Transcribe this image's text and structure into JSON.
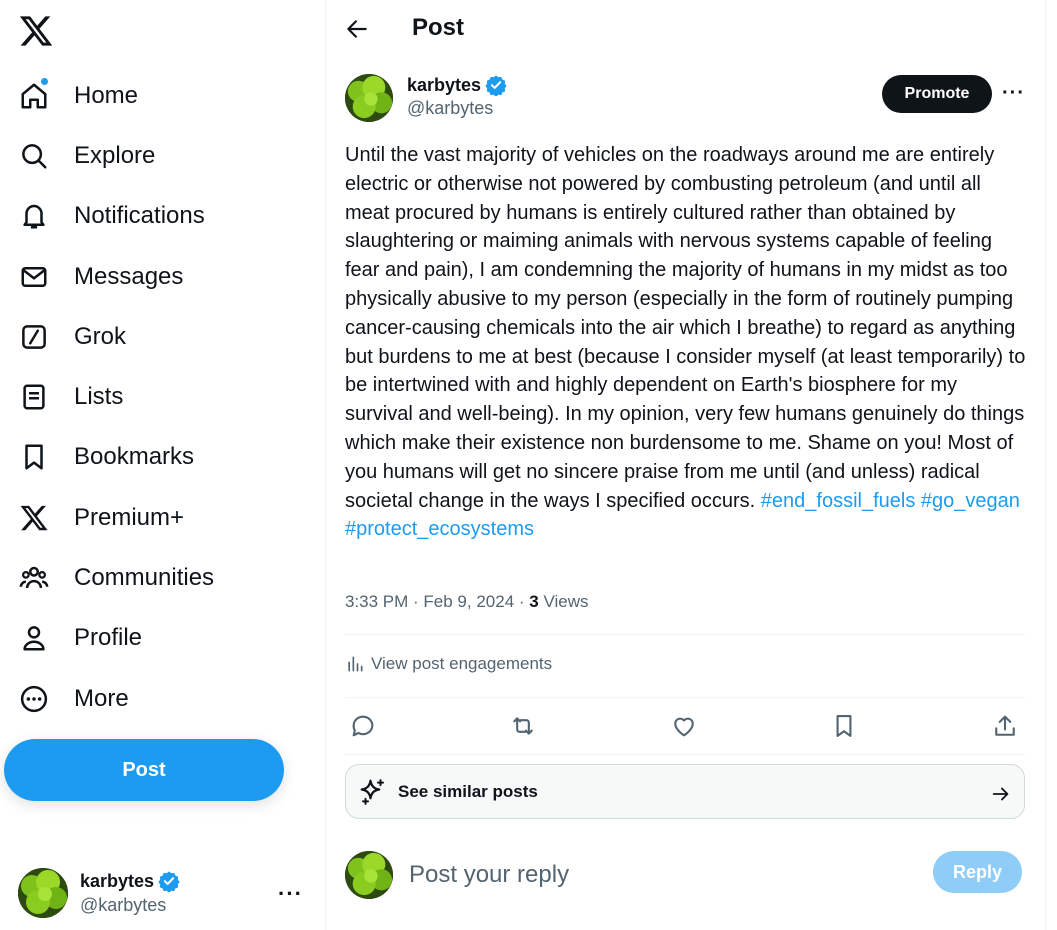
{
  "nav": {
    "items": [
      {
        "label": "Home",
        "icon": "home-icon"
      },
      {
        "label": "Explore",
        "icon": "search-icon"
      },
      {
        "label": "Notifications",
        "icon": "bell-icon"
      },
      {
        "label": "Messages",
        "icon": "envelope-icon"
      },
      {
        "label": "Grok",
        "icon": "grok-icon"
      },
      {
        "label": "Lists",
        "icon": "list-icon"
      },
      {
        "label": "Bookmarks",
        "icon": "bookmark-icon"
      },
      {
        "label": "Premium+",
        "icon": "x-logo-icon"
      },
      {
        "label": "Communities",
        "icon": "people-icon"
      },
      {
        "label": "Profile",
        "icon": "person-icon"
      },
      {
        "label": "More",
        "icon": "more-circle-icon"
      }
    ],
    "post_button": "Post"
  },
  "account": {
    "name": "karbytes",
    "handle": "@karbytes"
  },
  "header": {
    "title": "Post"
  },
  "post": {
    "author_name": "karbytes",
    "author_handle": "@karbytes",
    "promote_label": "Promote",
    "body": "Until the vast majority of vehicles on the roadways around me are entirely electric or otherwise not powered by combusting petroleum (and until all meat procured by humans is entirely cultured rather than obtained by slaughtering or maiming animals with nervous systems capable of feeling fear and pain), I am condemning the majority of humans in my midst as too physically abusive to my person (especially in the form of routinely pumping cancer-causing chemicals into the air which I breathe) to regard as anything but burdens to me at best (because I consider myself (at least temporarily) to be intertwined with and highly dependent on Earth's biosphere for my survival and well-being). In my opinion, very few humans genuinely do things which make their existence non burdensome to me. Shame on you! Most of you humans will get no sincere praise from me until (and unless) radical societal change in the ways I specified occurs.",
    "hashtags": [
      "#end_fossil_fuels",
      "#go_vegan",
      "#protect_ecosystems"
    ],
    "timestamp": "3:33 PM · Feb 9, 2024 · ",
    "views_count": "3",
    "views_label": "Views",
    "engagements_label": "View post engagements"
  },
  "similar": {
    "label": "See similar posts"
  },
  "reply": {
    "placeholder": "Post your reply",
    "button": "Reply"
  },
  "colors": {
    "accent": "#1d9bf0",
    "text": "#0f1419",
    "muted": "#536471",
    "reply_disabled": "#8ecdf8"
  }
}
